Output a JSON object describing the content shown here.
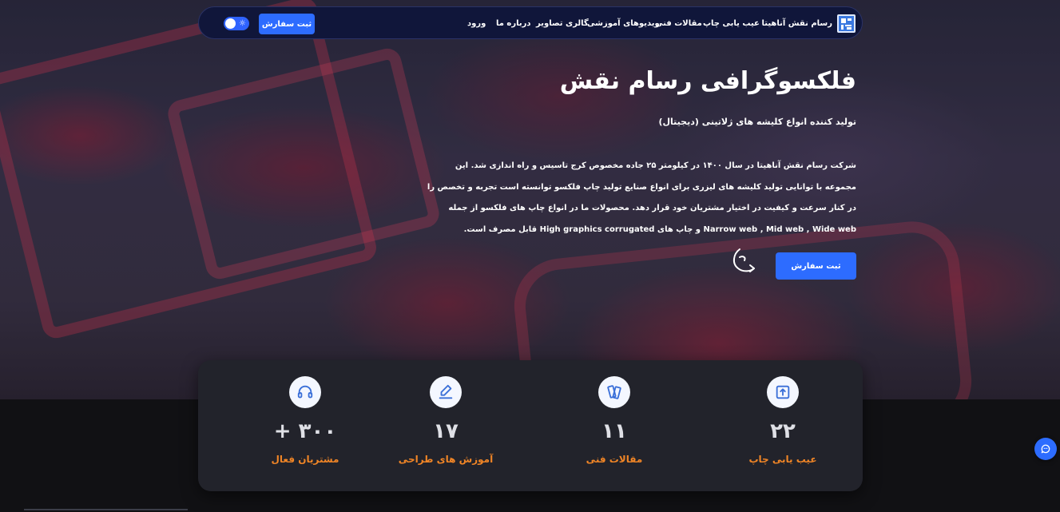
{
  "nav": {
    "brand": "رسام نقش آناهیتا",
    "links": [
      "عیب یابی چاپ",
      "مقالات فنی",
      "ویدیوهای آموزشی",
      "گالری تصاویر",
      "درباره ما",
      "ورود"
    ],
    "order_button": "ثبت سفارش",
    "theme_toggle": "dark-mode-toggle"
  },
  "hero": {
    "title": "فلکسوگرافی رسام نقش",
    "subtitle": "تولید کننده انواع کلیشه های ژلاتینی (دیجیتال)",
    "paragraph": "شرکت رسام نقش آناهیتا در سال ۱۴۰۰ در کیلومتر ۲۵ جاده مخصوص کرج تاسیس و راه اندازی شد. این مجموعه با توانایی تولید کلیشه های لیزری برای انواع صنایع تولید چاپ فلکسو توانسته است تجربه و تخصص را در کنار سرعت و کیفیت در اختیار مشتریان خود قرار دهد. محصولات ما در انواع چاپ های فلکسو از جمله Narrow web , Mid web , Wide web و چاپ های High graphics corrugated قابل مصرف است.",
    "cta": "ثبت سفارش"
  },
  "stats": [
    {
      "number": "۲۲",
      "label": "عیب یابی چاپ",
      "icon": "upload-file-icon"
    },
    {
      "number": "۱۱",
      "label": "مقالات فنی",
      "icon": "articles-icon"
    },
    {
      "number": "۱۷",
      "label": "آموزش های طراحی",
      "icon": "design-pen-icon"
    },
    {
      "number": "۳۰۰ +",
      "label": "مشتریان فعال",
      "icon": "headset-icon"
    }
  ],
  "colors": {
    "accent": "#2d6cff",
    "stat_label": "#f08526",
    "nav_bg": "#10163a",
    "stats_bg": "#22232b"
  }
}
